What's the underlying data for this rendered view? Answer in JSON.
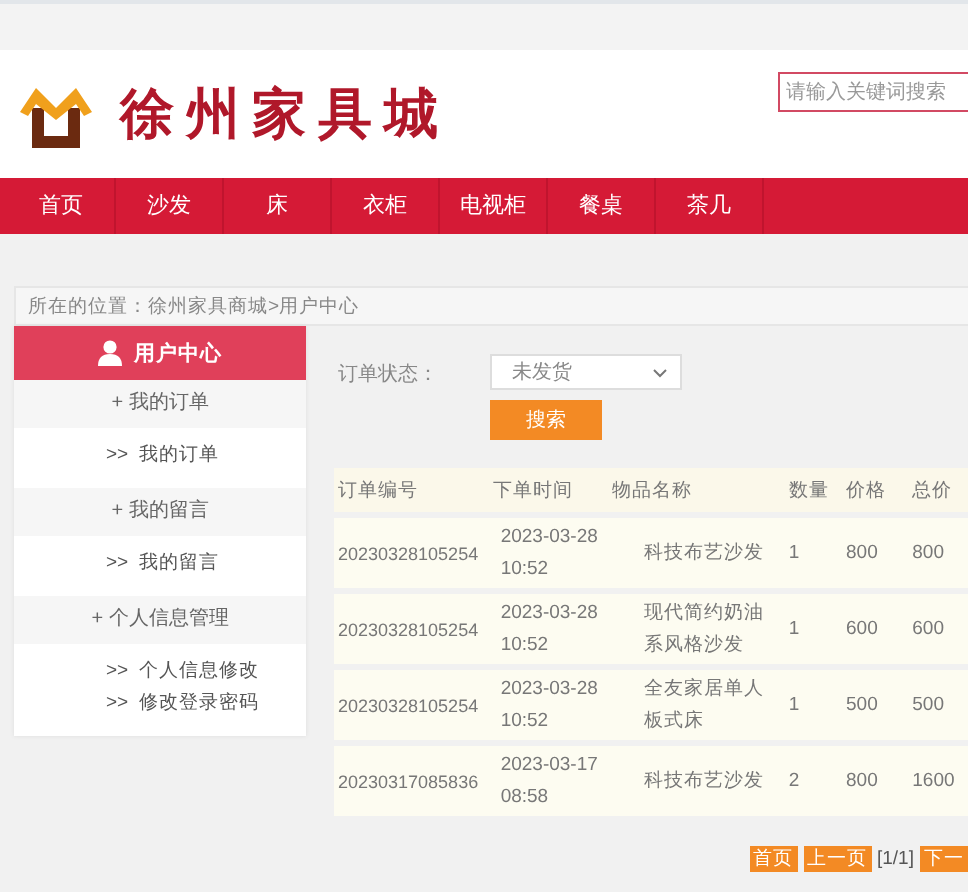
{
  "header": {
    "site_name": "徐州家具城",
    "search": {
      "placeholder": "请输入关键词搜索"
    }
  },
  "nav": [
    {
      "label": "首页"
    },
    {
      "label": "沙发"
    },
    {
      "label": "床"
    },
    {
      "label": "衣柜"
    },
    {
      "label": "电视柜"
    },
    {
      "label": "餐桌"
    },
    {
      "label": "茶几"
    }
  ],
  "breadcrumb": "所在的位置：徐州家具商城>用户中心",
  "sidebar": {
    "title": "用户中心",
    "sections": [
      {
        "title": "+ 我的订单",
        "links": [
          ">>  我的订单"
        ]
      },
      {
        "title": "+ 我的留言",
        "links": [
          ">>  我的留言"
        ]
      },
      {
        "title": "+ 个人信息管理",
        "links": [
          ">>  个人信息修改",
          ">>  修改登录密码"
        ]
      }
    ]
  },
  "filter": {
    "label": "订单状态：",
    "value": "未发货",
    "button": "搜索"
  },
  "table": {
    "columns": [
      "订单编号",
      "下单时间",
      "物品名称",
      "数量",
      "价格",
      "总价"
    ],
    "rows": [
      [
        "20230328105254",
        "2023-03-28 10:52",
        "科技布艺沙发",
        "1",
        "800",
        "800"
      ],
      [
        "20230328105254",
        "2023-03-28 10:52",
        "现代简约奶油系风格沙发",
        "1",
        "600",
        "600"
      ],
      [
        "20230328105254",
        "2023-03-28 10:52",
        "全友家居单人板式床",
        "1",
        "500",
        "500"
      ],
      [
        "20230317085836",
        "2023-03-17 08:58",
        "科技布艺沙发",
        "2",
        "800",
        "1600"
      ]
    ]
  },
  "pagination": [
    {
      "label": "首页",
      "kind": "button"
    },
    {
      "label": "上一页",
      "kind": "button"
    },
    {
      "label": "[1/1]",
      "kind": "text"
    },
    {
      "label": "下一",
      "kind": "button"
    }
  ]
}
